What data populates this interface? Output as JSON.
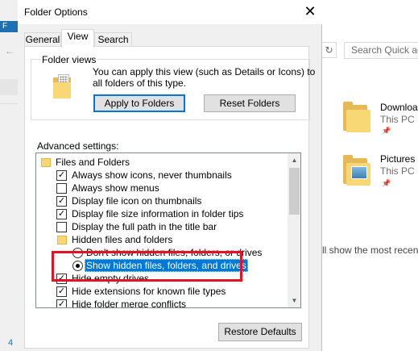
{
  "window": {
    "title": "Folder Options",
    "close_glyph": "✕"
  },
  "tabs": [
    {
      "label": "General",
      "active": false
    },
    {
      "label": "View",
      "active": true
    },
    {
      "label": "Search",
      "active": false
    }
  ],
  "folder_views": {
    "group_label": "Folder views",
    "description_line1": "You can apply this view (such as Details or Icons) to",
    "description_line2": "all folders of this type.",
    "apply_button": "Apply to Folders",
    "reset_button": "Reset Folders",
    "icon": "folder-views-icon"
  },
  "advanced": {
    "label": "Advanced settings:",
    "items": [
      {
        "type": "folder",
        "label": "Files and Folders"
      },
      {
        "type": "checkbox",
        "checked": true,
        "label": "Always show icons, never thumbnails"
      },
      {
        "type": "checkbox",
        "checked": false,
        "label": "Always show menus"
      },
      {
        "type": "checkbox",
        "checked": true,
        "label": "Display file icon on thumbnails"
      },
      {
        "type": "checkbox",
        "checked": true,
        "label": "Display file size information in folder tips"
      },
      {
        "type": "checkbox",
        "checked": false,
        "label": "Display the full path in the title bar"
      },
      {
        "type": "folder",
        "label": "Hidden files and folders"
      },
      {
        "type": "radio",
        "checked": false,
        "label": "Don't show hidden files, folders, or drives"
      },
      {
        "type": "radio",
        "checked": true,
        "selected": true,
        "label": "Show hidden files, folders, and drives"
      },
      {
        "type": "checkbox",
        "checked": true,
        "label": "Hide empty drives"
      },
      {
        "type": "checkbox",
        "checked": true,
        "label": "Hide extensions for known file types"
      },
      {
        "type": "checkbox",
        "checked": true,
        "label": "Hide folder merge conflicts"
      }
    ],
    "restore_button": "Restore Defaults",
    "highlight_color": "#e81123"
  },
  "background": {
    "search_placeholder": "Search Quick ac",
    "refresh_glyph": "↻",
    "blue_label": "F",
    "left_number": "4",
    "items": [
      {
        "name": "Downloa",
        "location": "This PC"
      },
      {
        "name": "Pictures",
        "location": "This PC"
      }
    ],
    "body_text": "ll show the most recen"
  },
  "colors": {
    "accent": "#0078d7",
    "dialog_bg": "#f0f0f0"
  }
}
